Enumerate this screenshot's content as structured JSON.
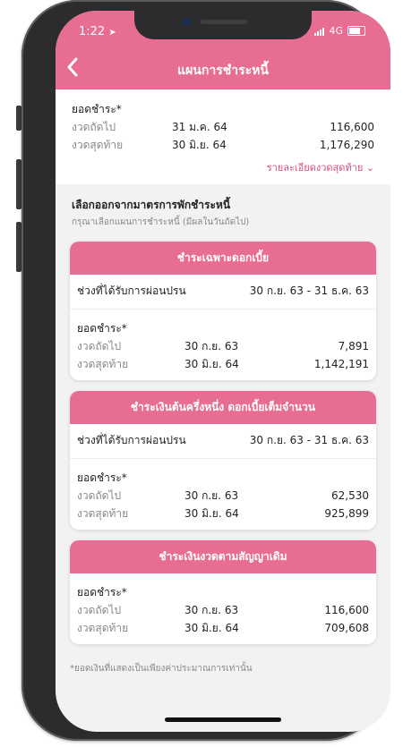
{
  "status_bar": {
    "time": "1:22",
    "network": "4G"
  },
  "header": {
    "title": "แผนการชำระหนี้"
  },
  "summary": {
    "label": "ยอดชำระ*",
    "rows": [
      {
        "label": "งวดถัดไป",
        "date": "31 ม.ค. 64",
        "amount": "116,600"
      },
      {
        "label": "งวดสุดท้าย",
        "date": "30 มิ.ย. 64",
        "amount": "1,176,290"
      }
    ],
    "detail_link": "รายละเอียดงวดสุดท้าย"
  },
  "section": {
    "title": "เลือกออกจากมาตรการพักชำระหนี้",
    "subtitle": "กรุณาเลือกแผนการชำระหนี้ (มีผลในวันถัดไป)"
  },
  "options": [
    {
      "title": "ชำระเฉพาะดอกเบี้ย",
      "period_label": "ช่วงที่ได้รับการผ่อนปรน",
      "period_value": "30 ก.ย. 63 - 31 ธ.ค. 63",
      "pay_label": "ยอดชำระ*",
      "rows": [
        {
          "label": "งวดถัดไป",
          "date": "30 ก.ย. 63",
          "amount": "7,891"
        },
        {
          "label": "งวดสุดท้าย",
          "date": "30 มิ.ย. 64",
          "amount": "1,142,191"
        }
      ]
    },
    {
      "title": "ชำระเงินต้นครึ่งหนึ่ง ดอกเบี้ยเต็มจำนวน",
      "period_label": "ช่วงที่ได้รับการผ่อนปรน",
      "period_value": "30 ก.ย. 63 - 31 ธ.ค. 63",
      "pay_label": "ยอดชำระ*",
      "rows": [
        {
          "label": "งวดถัดไป",
          "date": "30 ก.ย. 63",
          "amount": "62,530"
        },
        {
          "label": "งวดสุดท้าย",
          "date": "30 มิ.ย. 64",
          "amount": "925,899"
        }
      ]
    },
    {
      "title": "ชำระเงินงวดตามสัญญาเดิม",
      "pay_label": "ยอดชำระ*",
      "rows": [
        {
          "label": "งวดถัดไป",
          "date": "30 ก.ย. 63",
          "amount": "116,600"
        },
        {
          "label": "งวดสุดท้าย",
          "date": "30 มิ.ย. 64",
          "amount": "709,608"
        }
      ]
    }
  ],
  "footnote": "*ยอดเงินที่แสดงเป็นเพียงค่าประมาณการเท่านั้น",
  "colors": {
    "brand_pink": "#e86d92",
    "link_pink": "#d64d7a"
  }
}
